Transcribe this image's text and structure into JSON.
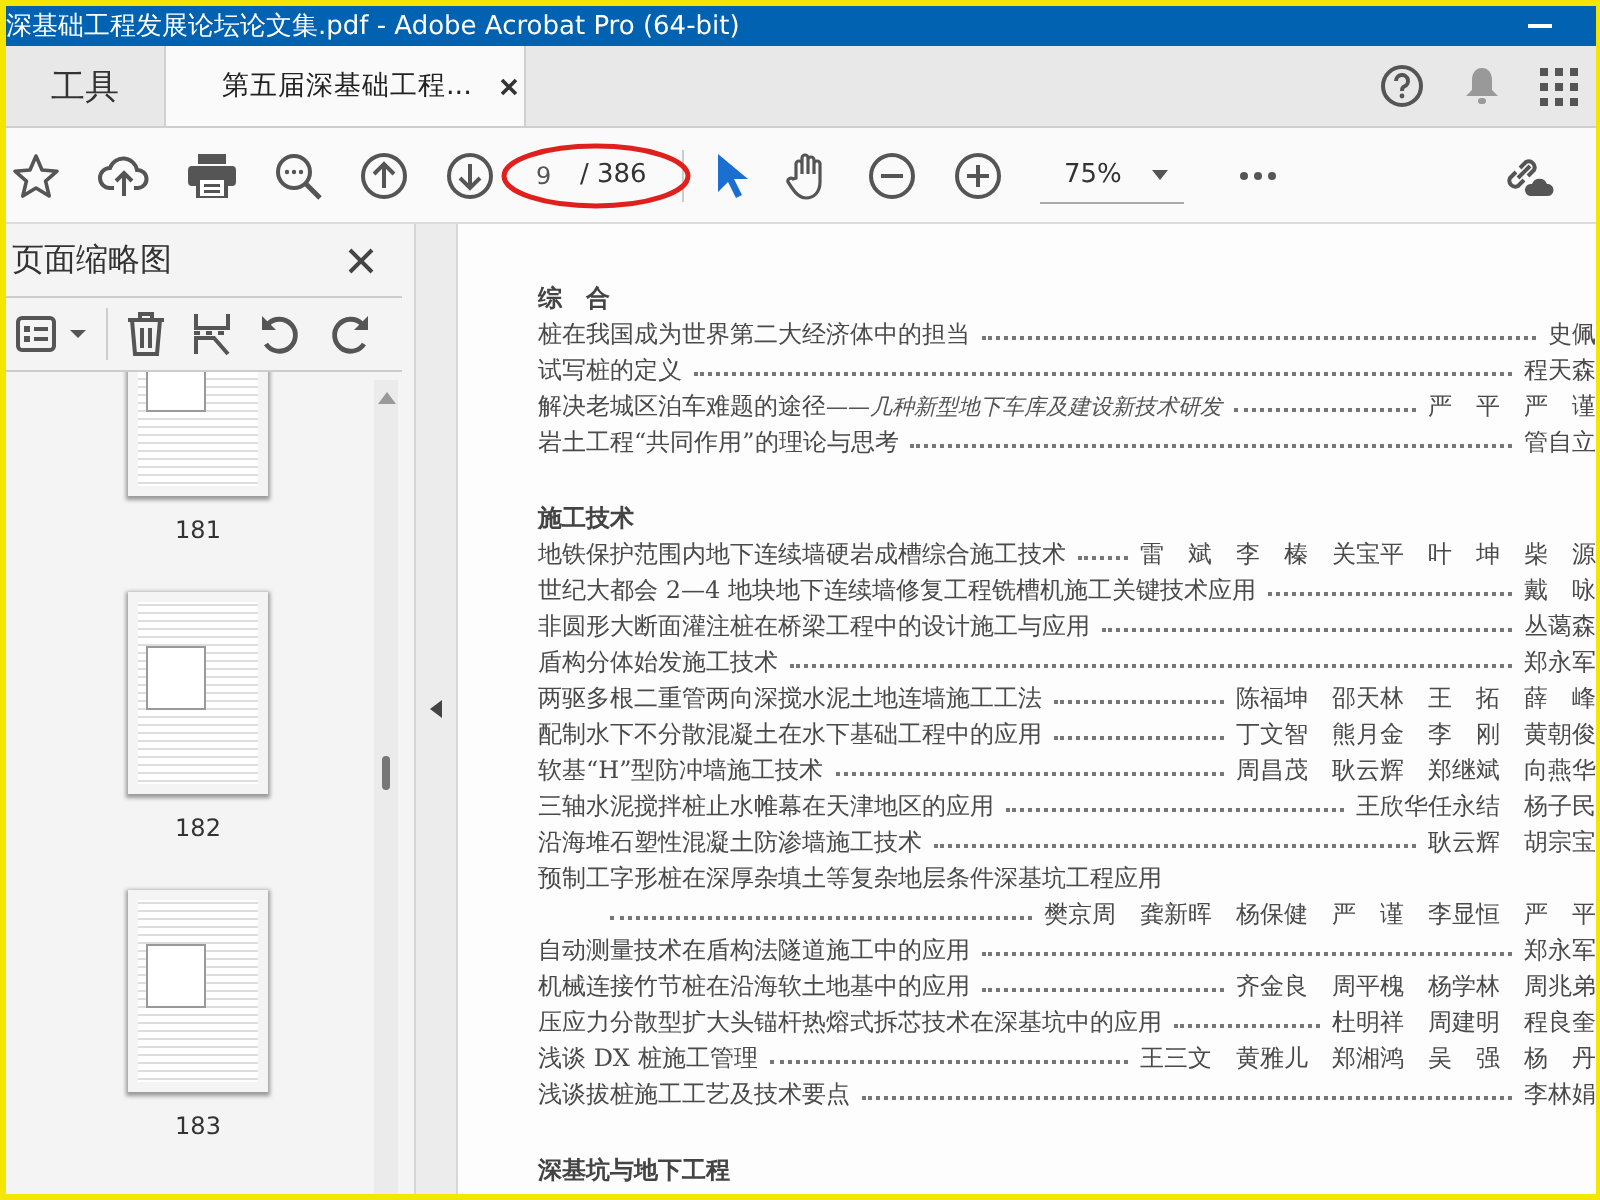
{
  "window": {
    "title": "深基础工程发展论坛论文集.pdf - Adobe Acrobat Pro (64-bit)"
  },
  "tabs": [
    {
      "label": "工具",
      "selected": false,
      "kind": "home"
    },
    {
      "label": "第五届深基础工程...",
      "selected": true,
      "kind": "document"
    }
  ],
  "toolbar": {
    "page_number": "9",
    "page_count": "/ 386",
    "zoom": "75%",
    "tools": [
      {
        "kind": "select",
        "selected": true
      },
      {
        "kind": "hand",
        "selected": false
      }
    ]
  },
  "thumbnails": {
    "title": "页面缩略图",
    "pages": [
      {
        "label": "181"
      },
      {
        "label": "182"
      },
      {
        "label": "183"
      }
    ]
  },
  "document": {
    "sections": [
      {
        "heading": "综　合",
        "entries": [
          {
            "title": "桩在我国成为世界第二大经济体中的担当",
            "authors": "史佩",
            "wrapped": false
          },
          {
            "title": "试写桩的定义",
            "authors": "程天森",
            "wrapped": false
          },
          {
            "title": "解决老城区泊车难题的途径",
            "subtitle": "——几种新型地下车库及建设新技术研发",
            "authors": "严　平　严　谨",
            "wrapped": false
          },
          {
            "title": "岩土工程“共同作用”的理论与思考",
            "authors": "管自立",
            "wrapped": false
          }
        ]
      },
      {
        "heading": "施工技术",
        "entries": [
          {
            "title": "地铁保护范围内地下连续墙硬岩成槽综合施工技术",
            "authors": "雷　斌　李　榛　关宝平　叶　坤　柴　源",
            "wrapped": false
          },
          {
            "title": "世纪大都会 2—4 地块地下连续墙修复工程铣槽机施工关键技术应用",
            "authors": "戴　咏",
            "wrapped": false
          },
          {
            "title": "非圆形大断面灌注桩在桥梁工程中的设计施工与应用",
            "authors": "丛蔼森",
            "wrapped": false
          },
          {
            "title": "盾构分体始发施工技术",
            "authors": "郑永军",
            "wrapped": false
          },
          {
            "title": "两驱多根二重管两向深搅水泥土地连墙施工工法",
            "authors": "陈福坤　邵天林　王　拓　薛　峰",
            "wrapped": false
          },
          {
            "title": "配制水下不分散混凝土在水下基础工程中的应用",
            "authors": "丁文智　熊月金　李　刚　黄朝俊",
            "wrapped": false
          },
          {
            "title": "软基“H”型防冲墙施工技术",
            "authors": "周昌茂　耿云辉　郑继斌　向燕华",
            "wrapped": false
          },
          {
            "title": "三轴水泥搅拌桩止水帷幕在天津地区的应用",
            "authors": "王欣华任永结　杨子民",
            "wrapped": false
          },
          {
            "title": "沿海堆石塑性混凝土防渗墙施工技术",
            "authors": "耿云辉　胡宗宝",
            "wrapped": false
          },
          {
            "title": "预制工字形桩在深厚杂填土等复杂地层条件深基坑工程应用",
            "authors": "樊京周　龚新晖　杨保健　严　谨　李显恒　严　平",
            "wrapped": true
          },
          {
            "title": "自动测量技术在盾构法隧道施工中的应用",
            "authors": "郑永军",
            "wrapped": false
          },
          {
            "title": "机械连接竹节桩在沿海软土地基中的应用",
            "authors": "齐金良　周平槐　杨学林　周兆弟",
            "wrapped": false
          },
          {
            "title": "压应力分散型扩大头锚杆热熔式拆芯技术在深基坑中的应用",
            "authors": "杜明祥　周建明　程良奎",
            "wrapped": false
          },
          {
            "title": "浅谈 DX 桩施工管理",
            "authors": "王三文　黄雅儿　郑湘鸿　吴　强　杨　丹",
            "wrapped": false
          },
          {
            "title": "浅谈拔桩施工工艺及技术要点",
            "authors": "李林娟",
            "wrapped": false
          }
        ]
      },
      {
        "heading": "深基坑与地下工程"
      }
    ]
  }
}
